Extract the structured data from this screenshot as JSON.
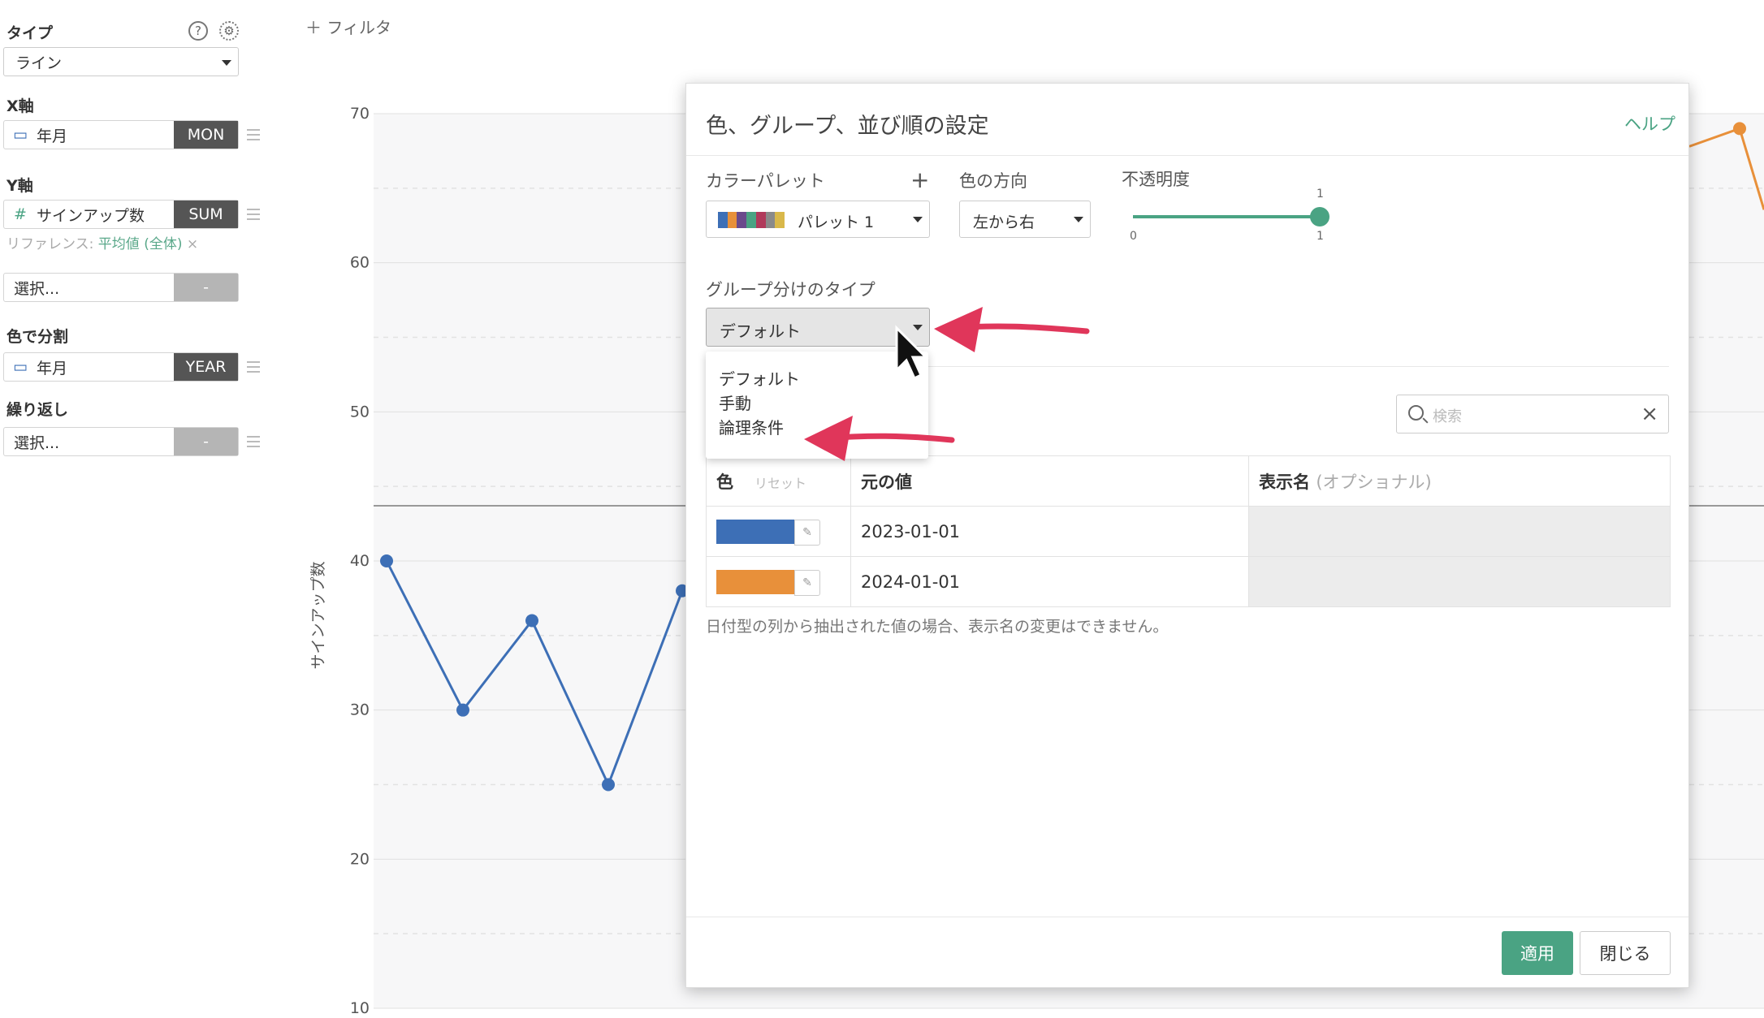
{
  "left_panel": {
    "type_label": "タイプ",
    "type_value": "ライン",
    "x_axis_label": "X軸",
    "x_field": "年月",
    "x_agg": "MON",
    "y_axis_label": "Y軸",
    "y_field": "サインアップ数",
    "y_agg": "SUM",
    "reference_prefix": "リファレンス: ",
    "reference_value": "平均値 (全体)",
    "reference_remove": "×",
    "select_placeholder": "選択...",
    "dash": "-",
    "color_split_label": "色で分割",
    "color_field": "年月",
    "color_agg": "YEAR",
    "repeat_label": "繰り返し",
    "repeat_placeholder": "選択...",
    "icons": {
      "help": "help-circle-icon",
      "settings": "gear-icon",
      "calendar": "calendar-icon",
      "hash": "#"
    }
  },
  "toolbar": {
    "filter_label": "＋ フィルタ"
  },
  "chart_data": {
    "type": "line",
    "ylabel": "サインアップ数",
    "yticks": [
      "70",
      "60",
      "50",
      "40",
      "30",
      "20",
      "10"
    ],
    "ylim": [
      10,
      70
    ],
    "series": [
      {
        "values": [
          40,
          30,
          36,
          25,
          38
        ]
      }
    ],
    "reference_line_value": 43.7,
    "series_color": "#3d6fb6",
    "partial_series_color": "#e8903a",
    "partial_series_point": 69
  },
  "modal": {
    "title": "色、グループ、並び順の設定",
    "help": "ヘルプ",
    "palette_label": "カラーパレット",
    "palette_add": "+",
    "palette_value": "パレット 1",
    "palette_colors": [
      "#3d6fb6",
      "#e8903a",
      "#6a4a8c",
      "#4aa383",
      "#b03a5b",
      "#8a8a8a",
      "#d9b84a"
    ],
    "direction_label": "色の方向",
    "direction_value": "左から右",
    "opacity_label": "不透明度",
    "opacity_min": "0",
    "opacity_max": "1",
    "opacity_value": "1",
    "group_type_label": "グループ分けのタイプ",
    "group_type_value": "デフォルト",
    "dropdown_options": [
      "デフォルト",
      "手動",
      "論理条件"
    ],
    "search_placeholder": "検索",
    "search_clear": "×",
    "table": {
      "col_color": "色",
      "col_reset": "リセット",
      "col_original": "元の値",
      "col_display": "表示名",
      "col_display_optional": "(オプショナル)",
      "rows": [
        {
          "color": "#3d6fb6",
          "value": "2023-01-01",
          "display": ""
        },
        {
          "color": "#e8903a",
          "value": "2024-01-01",
          "display": ""
        }
      ]
    },
    "note": "日付型の列から抽出された値の場合、表示名の変更はできません。",
    "apply": "適用",
    "close": "閉じる"
  },
  "accent_color": "#4aa383",
  "annotation_arrow_color": "#e0365a"
}
